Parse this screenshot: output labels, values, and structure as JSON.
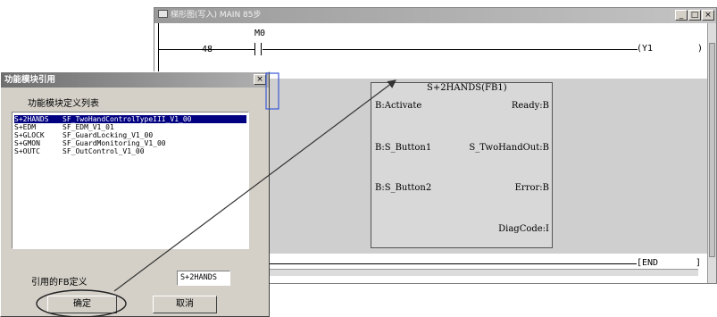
{
  "ladder_window": {
    "title": "梯形图(写入)  MAIN  85步",
    "min_label": "_",
    "max_label": "□",
    "close_label": "×",
    "contact_top": "M0",
    "step_48": "48",
    "coil_top": "(Y1",
    "coil_bracket": ")",
    "end_label": "[END",
    "end_bracket": "]"
  },
  "function_block": {
    "title": "S+2HANDS(FB1)",
    "in_activate": "B:Activate",
    "in_button1": "B:S_Button1",
    "in_button2": "B:S_Button2",
    "out_ready": "Ready:B",
    "out_twohand": "S_TwoHandOut:B",
    "out_error": "Error:B",
    "out_diag": "DiagCode:I"
  },
  "dialog": {
    "title": "功能模块引用",
    "close_label": "×",
    "list_label": "功能模块定义列表",
    "items": [
      {
        "code": "S+2HANDS",
        "name": "SF_TwoHandControlTypeIII_V1_00"
      },
      {
        "code": "S+EDM",
        "name": "SF_EDM_V1_01"
      },
      {
        "code": "S+GLOCK",
        "name": "SF_GuardLocking_V1_00"
      },
      {
        "code": "S+GMON",
        "name": "SF_GuardMonitoring_V1_00"
      },
      {
        "code": "S+OUTC",
        "name": "SF_OutControl_V1_00"
      }
    ],
    "fb_def_label": "引用的FB定义",
    "fb_def_value": "S+2HANDS",
    "ok_label": "确定",
    "cancel_label": "取消"
  }
}
